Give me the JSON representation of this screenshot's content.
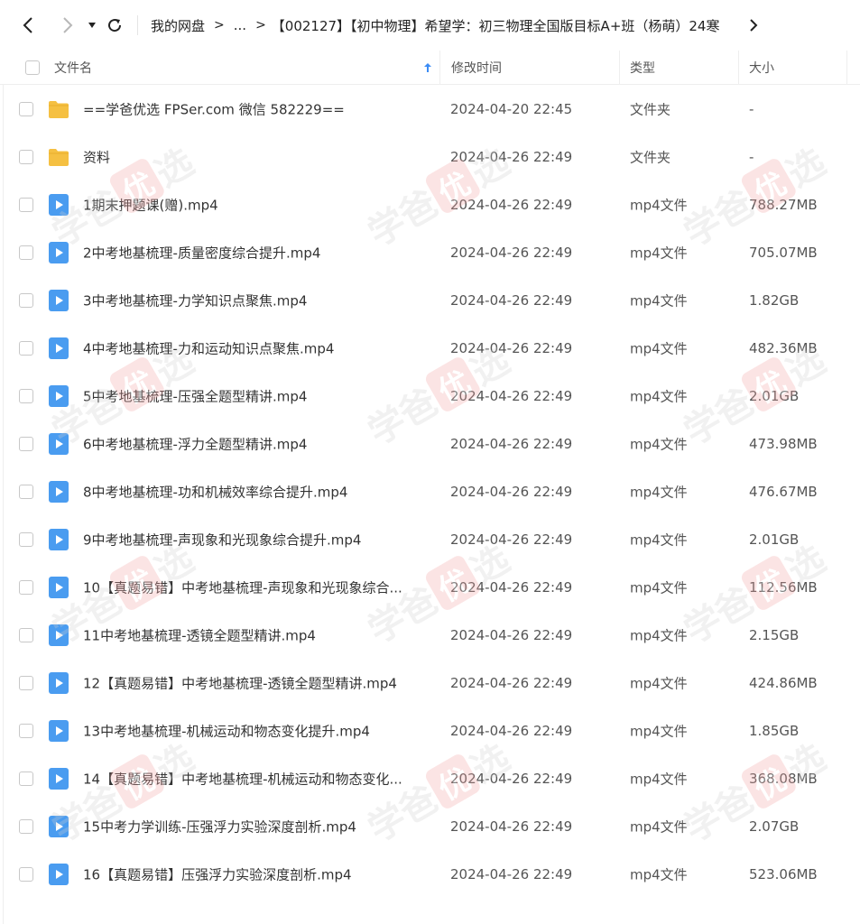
{
  "toolbar": {
    "breadcrumbs": [
      "我的网盘",
      "...",
      "【002127】【初中物理】希望学：初三物理全国版目标A+班（杨萌）24寒"
    ],
    "separator": ">"
  },
  "columns": {
    "name": "文件名",
    "modified": "修改时间",
    "type": "类型",
    "size": "大小"
  },
  "watermark": {
    "part1": "学爸",
    "part2": "优",
    "part3": "选"
  },
  "files": [
    {
      "icon": "folder-icon",
      "name": "==学爸优选 FPSer.com 微信 582229==",
      "modified": "2024-04-20 22:45",
      "type": "文件夹",
      "size": "-"
    },
    {
      "icon": "folder-icon",
      "name": "资料",
      "modified": "2024-04-26 22:49",
      "type": "文件夹",
      "size": "-"
    },
    {
      "icon": "video-icon",
      "name": "1期末押题课(赠).mp4",
      "modified": "2024-04-26 22:49",
      "type": "mp4文件",
      "size": "788.27MB"
    },
    {
      "icon": "video-icon",
      "name": "2中考地基梳理-质量密度综合提升.mp4",
      "modified": "2024-04-26 22:49",
      "type": "mp4文件",
      "size": "705.07MB"
    },
    {
      "icon": "video-icon",
      "name": "3中考地基梳理-力学知识点聚焦.mp4",
      "modified": "2024-04-26 22:49",
      "type": "mp4文件",
      "size": "1.82GB"
    },
    {
      "icon": "video-icon",
      "name": "4中考地基梳理-力和运动知识点聚焦.mp4",
      "modified": "2024-04-26 22:49",
      "type": "mp4文件",
      "size": "482.36MB"
    },
    {
      "icon": "video-icon",
      "name": "5中考地基梳理-压强全题型精讲.mp4",
      "modified": "2024-04-26 22:49",
      "type": "mp4文件",
      "size": "2.01GB"
    },
    {
      "icon": "video-icon",
      "name": "6中考地基梳理-浮力全题型精讲.mp4",
      "modified": "2024-04-26 22:49",
      "type": "mp4文件",
      "size": "473.98MB"
    },
    {
      "icon": "video-icon",
      "name": "8中考地基梳理-功和机械效率综合提升.mp4",
      "modified": "2024-04-26 22:49",
      "type": "mp4文件",
      "size": "476.67MB"
    },
    {
      "icon": "video-icon",
      "name": "9中考地基梳理-声现象和光现象综合提升.mp4",
      "modified": "2024-04-26 22:49",
      "type": "mp4文件",
      "size": "2.01GB"
    },
    {
      "icon": "video-icon",
      "name": "10【真题易错】中考地基梳理-声现象和光现象综合...",
      "modified": "2024-04-26 22:49",
      "type": "mp4文件",
      "size": "112.56MB"
    },
    {
      "icon": "video-icon",
      "name": "11中考地基梳理-透镜全题型精讲.mp4",
      "modified": "2024-04-26 22:49",
      "type": "mp4文件",
      "size": "2.15GB"
    },
    {
      "icon": "video-icon",
      "name": "12【真题易错】中考地基梳理-透镜全题型精讲.mp4",
      "modified": "2024-04-26 22:49",
      "type": "mp4文件",
      "size": "424.86MB"
    },
    {
      "icon": "video-icon",
      "name": "13中考地基梳理-机械运动和物态变化提升.mp4",
      "modified": "2024-04-26 22:49",
      "type": "mp4文件",
      "size": "1.85GB"
    },
    {
      "icon": "video-icon",
      "name": "14【真题易错】中考地基梳理-机械运动和物态变化...",
      "modified": "2024-04-26 22:49",
      "type": "mp4文件",
      "size": "368.08MB"
    },
    {
      "icon": "video-icon",
      "name": "15中考力学训练-压强浮力实验深度剖析.mp4",
      "modified": "2024-04-26 22:49",
      "type": "mp4文件",
      "size": "2.07GB"
    },
    {
      "icon": "video-icon",
      "name": "16【真题易错】压强浮力实验深度剖析.mp4",
      "modified": "2024-04-26 22:49",
      "type": "mp4文件",
      "size": "523.06MB"
    }
  ],
  "colors": {
    "folder": "#F5C042",
    "video": "#4A9CF0",
    "sort_arrow": "#3B8CF5"
  }
}
